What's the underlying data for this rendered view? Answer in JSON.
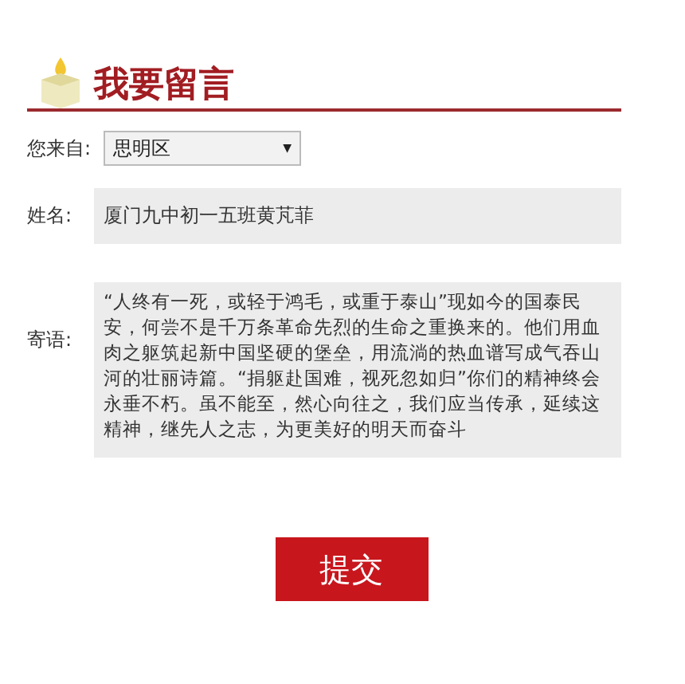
{
  "title": "我要留言",
  "fields": [
    {
      "kind": "select",
      "label": "您来自:",
      "value": "思明区",
      "caret": "▼"
    },
    {
      "kind": "text",
      "label": "姓名:",
      "value": "厦门九中初一五班黄芃菲"
    },
    {
      "kind": "textarea",
      "label": "寄语:",
      "value": "“人终有一死，或轻于鸿毛，或重于泰山”现如今的国泰民安，何尝不是千万条革命先烈的生命之重换来的。他们用血肉之躯筑起新中国坚硬的堡垒，用流淌的热血谱写成气吞山河的壮丽诗篇。“捐躯赴国难，视死忽如归”你们的精神终会永垂不朽。虽不能至，然心向往之，我们应当传承，延续这精神，继先人之志，为更美好的明天而奋斗"
    }
  ],
  "submit": "提交"
}
